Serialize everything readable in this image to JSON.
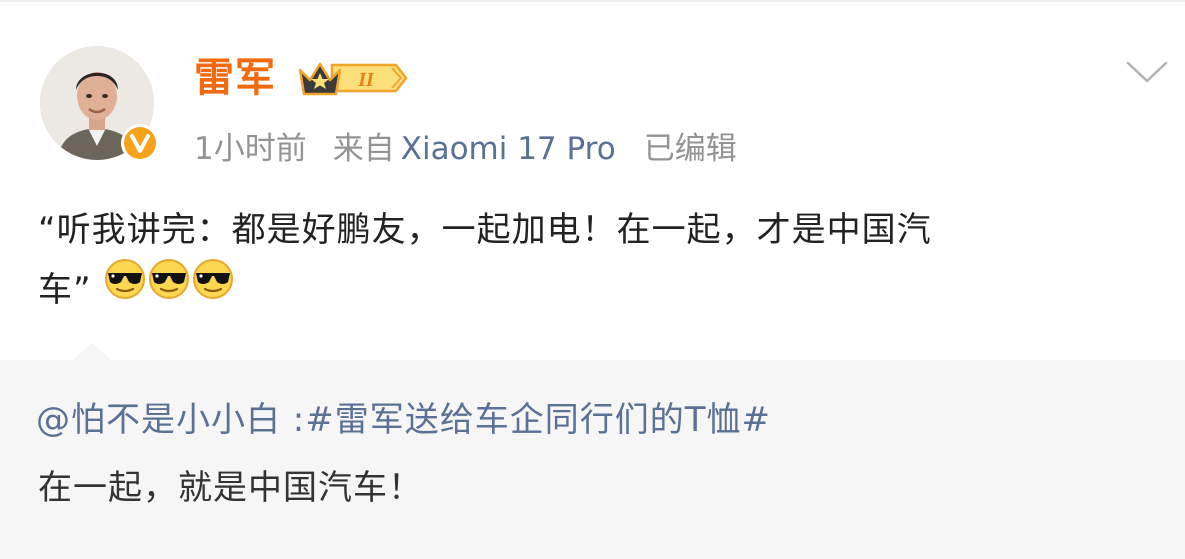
{
  "post": {
    "author": "雷军",
    "rank_badge": "II",
    "verified_badge": "V",
    "time": "1小时前",
    "source_prefix": "来自",
    "device": "Xiaomi 17 Pro",
    "edited": "已编辑",
    "text_line1": "“听我讲完：都是好鹏友，一起加电！在一起，才是中国汽",
    "text_line2": "车”",
    "emoji_name": "sunglasses-face-icon",
    "emoji_count": 3
  },
  "repost": {
    "mention": "@怕不是小小白",
    "separator": " :",
    "hashtag": "#雷军送给车企同行们的T恤#",
    "text": "在一起，就是中国汽车！"
  },
  "colors": {
    "username": "#f26a0f",
    "link": "#5a7195",
    "meta": "#939393",
    "text": "#222222",
    "repost_bg": "#f6f6f6",
    "verified": "#f7a21b"
  }
}
